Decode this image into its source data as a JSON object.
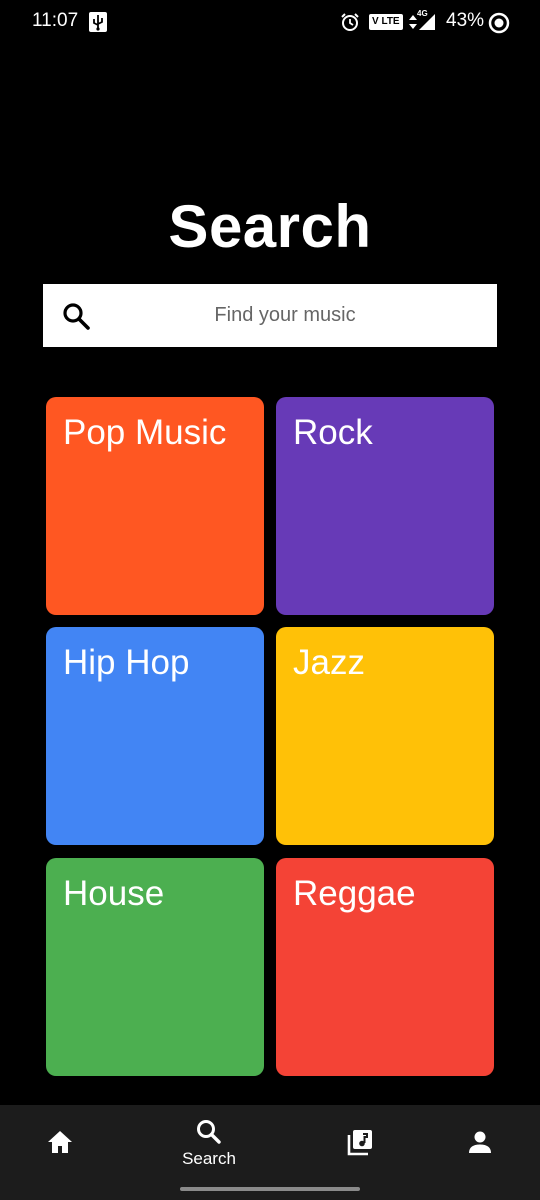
{
  "status_bar": {
    "time": "11:07",
    "volte": "V LTE",
    "network": "4G",
    "battery": "43%",
    "icons": [
      "usb-icon",
      "alarm-icon",
      "data-arrows-icon",
      "signal-icon",
      "battery-icon"
    ]
  },
  "page": {
    "title": "Search"
  },
  "search": {
    "placeholder": "Find your music",
    "icon": "search-icon"
  },
  "genres": [
    {
      "label": "Pop Music",
      "color": "#FF5722"
    },
    {
      "label": "Rock",
      "color": "#673AB7"
    },
    {
      "label": "Hip Hop",
      "color": "#4285F4"
    },
    {
      "label": "Jazz",
      "color": "#FFC107"
    },
    {
      "label": "House",
      "color": "#4CAF50"
    },
    {
      "label": "Reggae",
      "color": "#F44336"
    }
  ],
  "bottom_nav": {
    "items": [
      {
        "icon": "home-icon",
        "label": ""
      },
      {
        "icon": "search-icon",
        "label": "Search"
      },
      {
        "icon": "library-music-icon",
        "label": ""
      },
      {
        "icon": "person-icon",
        "label": ""
      }
    ],
    "active": "Search"
  }
}
